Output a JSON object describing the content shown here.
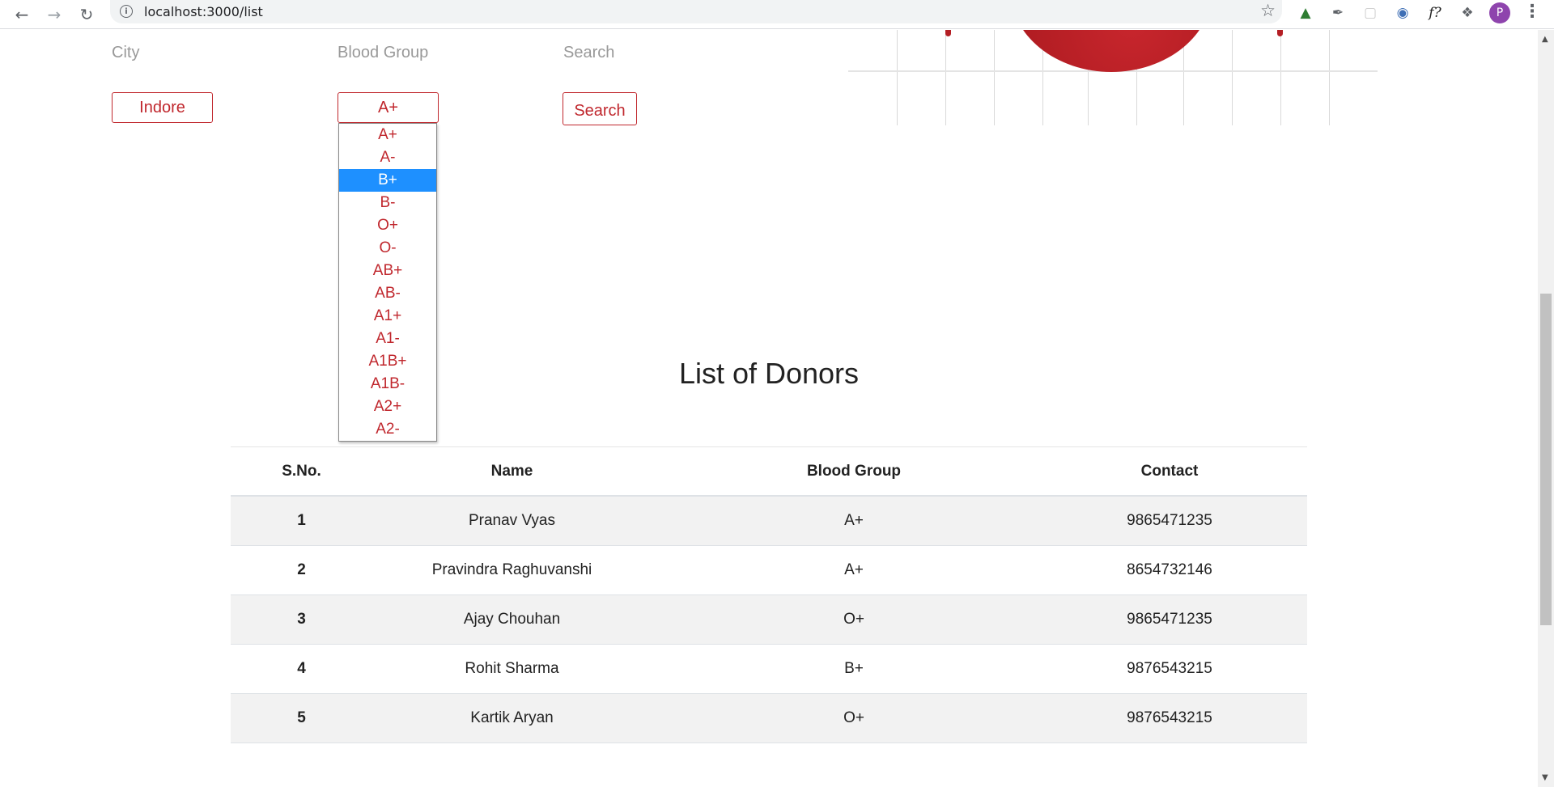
{
  "browser": {
    "url": "localhost:3000/list",
    "avatar_letter": "P",
    "icons": [
      "back-icon",
      "forward-icon",
      "reload-icon",
      "site-info-icon",
      "bookmark-star-icon",
      "html-tree-extension-icon",
      "eyedropper-extension-icon",
      "extension-icon",
      "extension-icon",
      "font-extension-icon",
      "puzzle-extensions-icon",
      "menu-dots-icon"
    ]
  },
  "filters": {
    "city_label": "City",
    "city_value": "Indore",
    "blood_group_label": "Blood Group",
    "blood_group_value": "A+",
    "search_label": "Search",
    "search_button": "Search",
    "options": [
      "A+",
      "A-",
      "B+",
      "B-",
      "O+",
      "O-",
      "AB+",
      "AB-",
      "A1+",
      "A1-",
      "A1B+",
      "A1B-",
      "A2+",
      "A2-"
    ],
    "highlighted_option": "B+"
  },
  "colors": {
    "accent": "#c0272d",
    "highlight": "#1e90ff"
  },
  "title": "List of Donors",
  "table": {
    "headers": [
      "S.No.",
      "Name",
      "Blood Group",
      "Contact"
    ],
    "rows": [
      [
        "1",
        "Pranav Vyas",
        "A+",
        "9865471235"
      ],
      [
        "2",
        "Pravindra Raghuvanshi",
        "A+",
        "8654732146"
      ],
      [
        "3",
        "Ajay Chouhan",
        "O+",
        "9865471235"
      ],
      [
        "4",
        "Rohit Sharma",
        "B+",
        "9876543215"
      ],
      [
        "5",
        "Kartik Aryan",
        "O+",
        "9876543215"
      ]
    ]
  }
}
